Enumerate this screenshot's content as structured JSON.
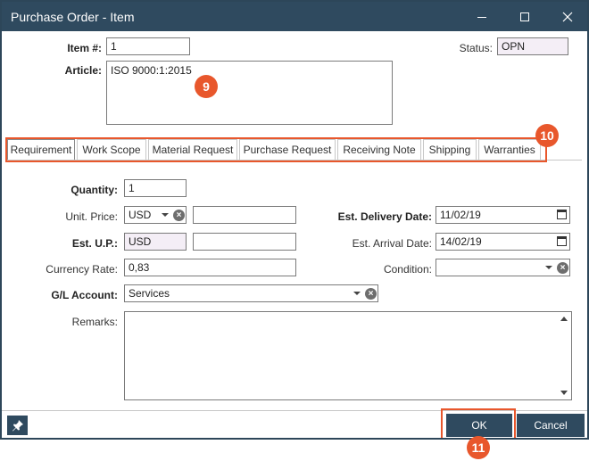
{
  "window": {
    "title": "Purchase Order - Item",
    "controls": [
      "minimize-icon",
      "maximize-icon",
      "close-icon"
    ]
  },
  "header": {
    "item_label": "Item #:",
    "item_value": "1",
    "status_label": "Status:",
    "status_value": "OPN",
    "article_label": "Article:",
    "article_value": "ISO 9000:1:2015"
  },
  "tabs": [
    {
      "label": "Requirement",
      "active": true
    },
    {
      "label": "Work Scope"
    },
    {
      "label": "Material Request"
    },
    {
      "label": "Purchase Request"
    },
    {
      "label": "Receiving Note"
    },
    {
      "label": "Shipping"
    },
    {
      "label": "Warranties"
    }
  ],
  "form": {
    "quantity_label": "Quantity:",
    "quantity_value": "1",
    "unit_price_label": "Unit. Price:",
    "unit_price_currency": "USD",
    "unit_price_value": "",
    "est_up_label": "Est. U.P.:",
    "est_up_currency": "USD",
    "est_up_value": "",
    "currency_rate_label": "Currency Rate:",
    "currency_rate_value": "0,83",
    "gl_account_label": "G/L Account:",
    "gl_account_value": "Services",
    "remarks_label": "Remarks:",
    "remarks_value": "",
    "est_delivery_label": "Est. Delivery Date:",
    "est_delivery_value": "11/02/19",
    "est_arrival_label": "Est. Arrival Date:",
    "est_arrival_value": "14/02/19",
    "condition_label": "Condition:",
    "condition_value": ""
  },
  "footer": {
    "pin_icon": "pin-icon",
    "ok_label": "OK",
    "cancel_label": "Cancel"
  },
  "annotations": {
    "badge_9": "9",
    "badge_10": "10",
    "badge_11": "11",
    "color": "#e8572c"
  },
  "colors": {
    "titlebar": "#2f4a5f",
    "button": "#2f4a5f",
    "readonly_field": "#f4eef6"
  }
}
